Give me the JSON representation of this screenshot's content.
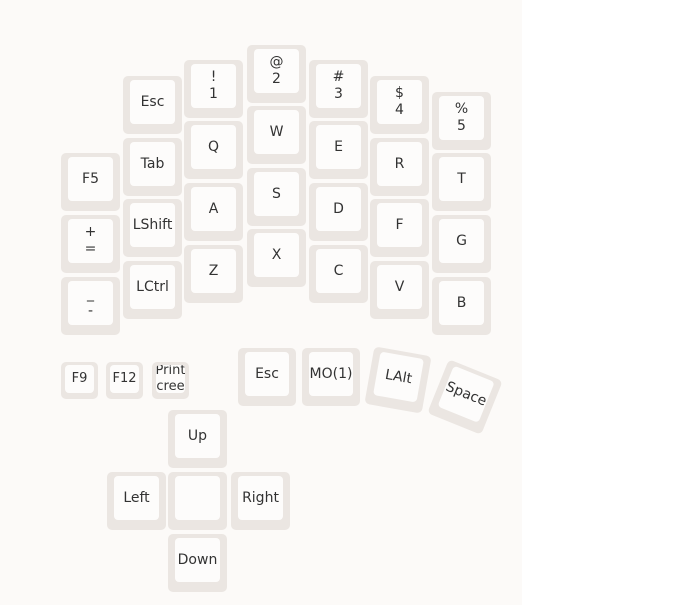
{
  "keyboard": {
    "finger_keys": {
      "row_numbers": {
        "esc": "Esc",
        "one": [
          "!",
          "1"
        ],
        "two": [
          "@",
          "2"
        ],
        "three": [
          "#",
          "3"
        ],
        "four": [
          "$",
          "4"
        ],
        "five": [
          "%",
          "5"
        ]
      },
      "row_top": {
        "f5": "F5",
        "tab": "Tab",
        "q": "Q",
        "w": "W",
        "e": "E",
        "r": "R",
        "t": "T"
      },
      "row_home": {
        "plus_equals": [
          "+",
          "="
        ],
        "lshift": "LShift",
        "a": "A",
        "s": "S",
        "d": "D",
        "f": "F",
        "g": "G"
      },
      "row_bottom": {
        "underscore_minus": [
          "_",
          "-"
        ],
        "lctrl": "LCtrl",
        "z": "Z",
        "x": "X",
        "c": "C",
        "v": "V",
        "b": "B"
      }
    },
    "function_keys": {
      "f9": "F9",
      "f12": "F12",
      "print_screen": [
        "Print",
        "Screen"
      ]
    },
    "thumb_keys": {
      "esc": "Esc",
      "mo1": "MO(1)",
      "lalt": "LAlt",
      "space": "Space"
    },
    "arrow_keys": {
      "up": "Up",
      "left": "Left",
      "center": "",
      "right": "Right",
      "down": "Down"
    }
  }
}
